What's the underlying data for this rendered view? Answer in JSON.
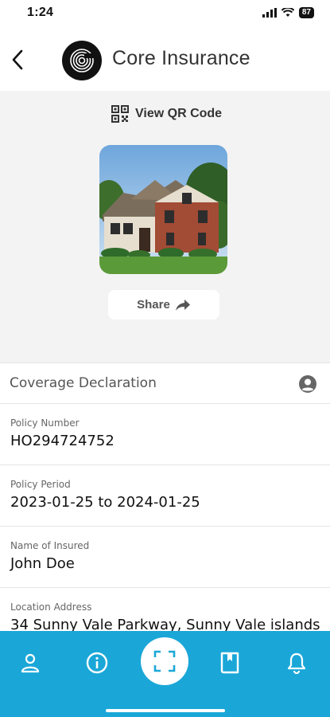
{
  "status_bar": {
    "time": "1:24",
    "battery": "87",
    "icons": [
      "signal-icon",
      "wifi-icon",
      "battery-icon"
    ]
  },
  "header": {
    "title": "Core Insurance",
    "back_icon": "back-arrow-icon",
    "logo_icon": "core-logo-icon"
  },
  "hero": {
    "qr_label": "View QR Code",
    "share_label": "Share"
  },
  "coverage": {
    "title": "Coverage Declaration",
    "fields": [
      {
        "label": "Policy Number",
        "value": "HO294724752"
      },
      {
        "label": "Policy Period",
        "value": "2023-01-25 to 2024-01-25"
      },
      {
        "label": "Name of Insured",
        "value": "John Doe"
      },
      {
        "label": "Location Address",
        "value": "34 Sunny Vale Parkway, Sunny Vale islands"
      }
    ]
  },
  "bottom_nav": {
    "items": [
      "profile-icon",
      "info-icon",
      "scan-icon",
      "book-icon",
      "bell-icon"
    ]
  },
  "colors": {
    "accent": "#1aa7d8",
    "hero_bg": "#f3f3f3"
  }
}
